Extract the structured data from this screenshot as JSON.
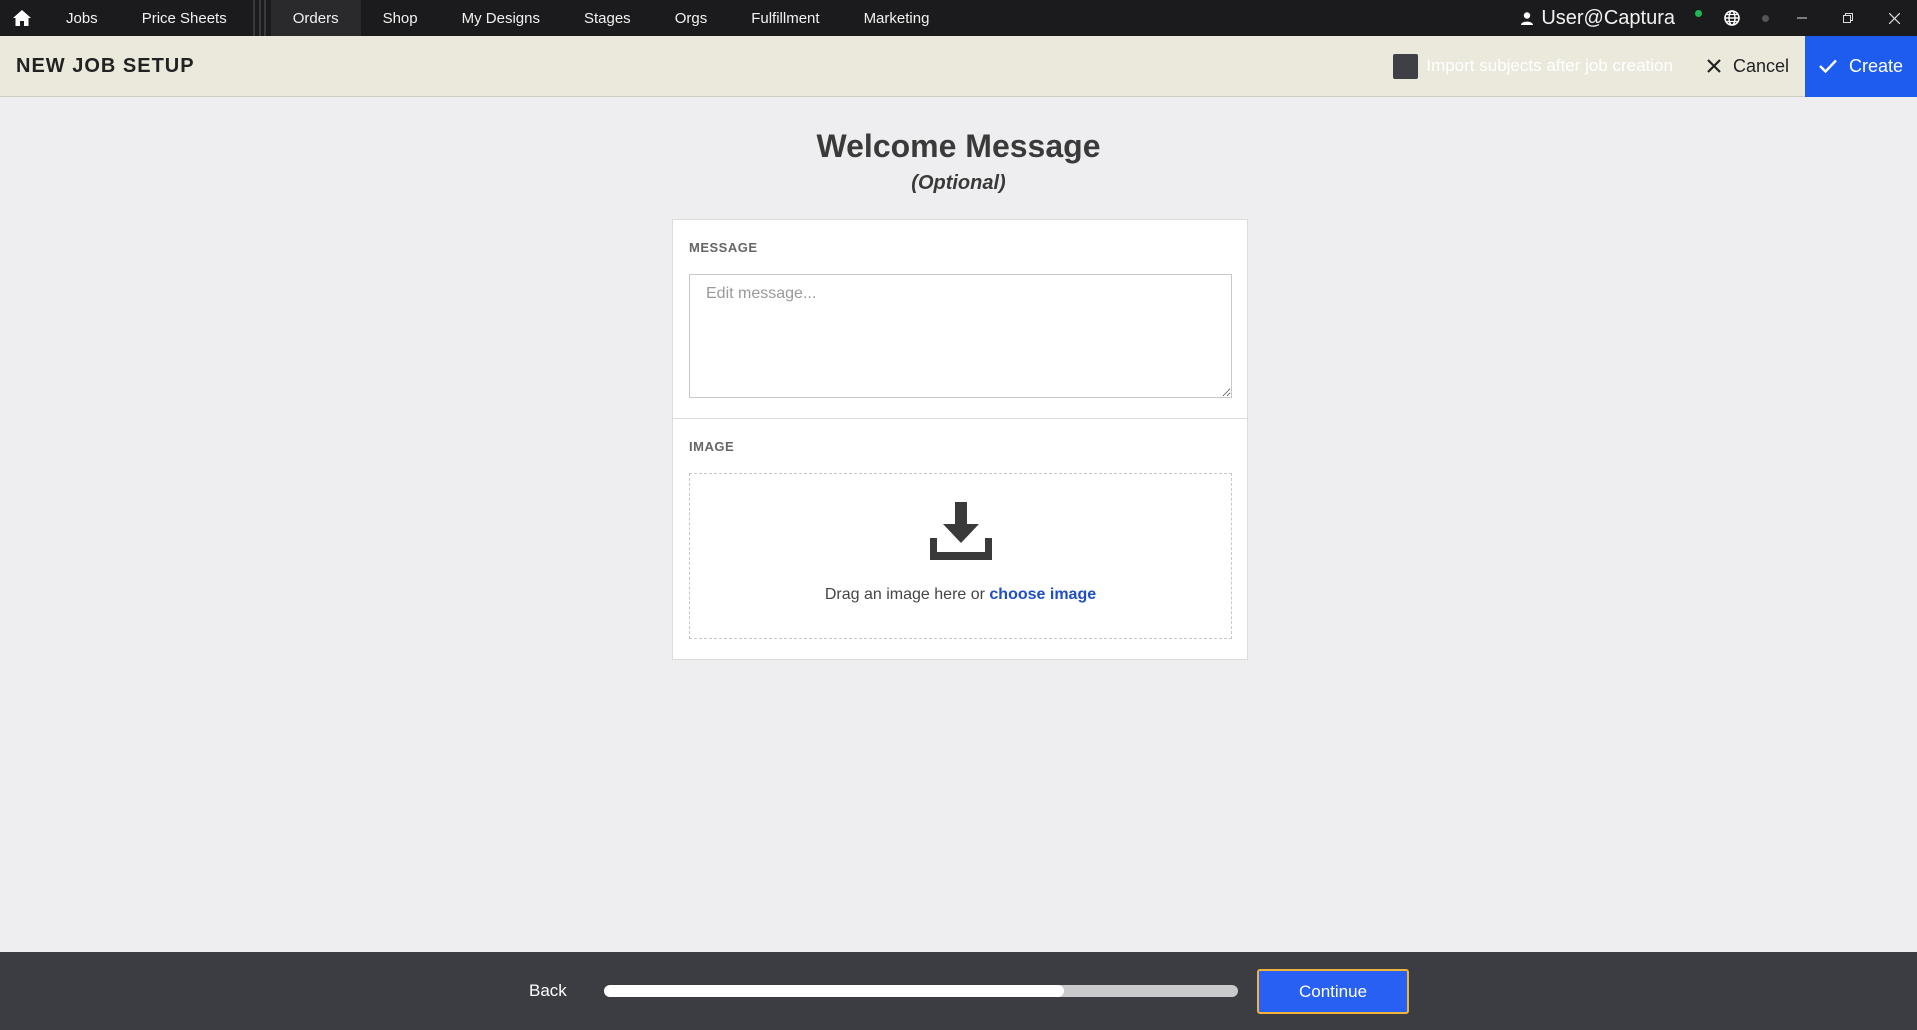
{
  "topbar": {
    "nav_left": [
      {
        "label": "Jobs"
      },
      {
        "label": "Price Sheets"
      }
    ],
    "nav_right": [
      {
        "label": "Orders"
      },
      {
        "label": "Shop"
      },
      {
        "label": "My Designs"
      },
      {
        "label": "Stages"
      },
      {
        "label": "Orgs"
      },
      {
        "label": "Fulfillment"
      },
      {
        "label": "Marketing"
      }
    ],
    "user": "User@Captura",
    "status_color": "#1db954"
  },
  "jobbar": {
    "title": "NEW JOB SETUP",
    "import_label": "Import subjects after job creation",
    "cancel_label": "Cancel",
    "create_label": "Create"
  },
  "main": {
    "title": "Welcome Message",
    "subtitle": "(Optional)",
    "message_label": "MESSAGE",
    "message_placeholder": "Edit message...",
    "message_value": "",
    "image_label": "IMAGE",
    "drop_text": "Drag an image here or ",
    "choose_link": "choose image"
  },
  "footer": {
    "back_label": "Back",
    "progress_percent": 72.5,
    "continue_label": "Continue"
  },
  "colors": {
    "accent": "#1e5cf0",
    "focus_border": "#f0b43b",
    "link": "#1e4fc4"
  }
}
